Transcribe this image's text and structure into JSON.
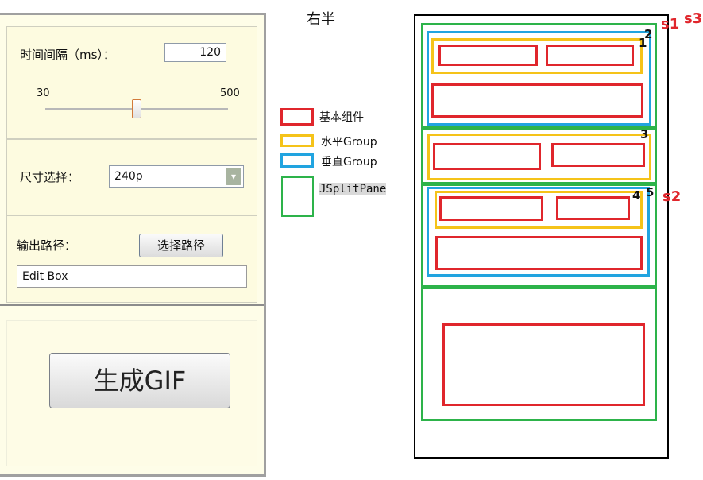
{
  "left_panel": {
    "interval": {
      "label": "时间间隔（ms）：",
      "value": "120"
    },
    "slider": {
      "min_label": "30",
      "max_label": "500",
      "value_fraction": 0.5
    },
    "size": {
      "label": "尺寸选择：",
      "selected": "240p",
      "arrow": "▾"
    },
    "output": {
      "label": "输出路径：",
      "button_label": "选择路径",
      "edit_box": "Edit Box"
    },
    "generate": {
      "button_label": "生成GIF"
    }
  },
  "diagram": {
    "title": "右半",
    "legend": [
      {
        "text": "基本组件",
        "color": "#e0262c"
      },
      {
        "text": "水平Group",
        "color": "#f5c319"
      },
      {
        "text": "垂直Group",
        "color": "#21a4e0"
      },
      {
        "text": "JSplitPane",
        "color": "#2db34a"
      }
    ],
    "numbers": [
      "1",
      "2",
      "3",
      "4",
      "5"
    ],
    "split_labels": [
      "s1",
      "s3",
      "s2"
    ]
  }
}
